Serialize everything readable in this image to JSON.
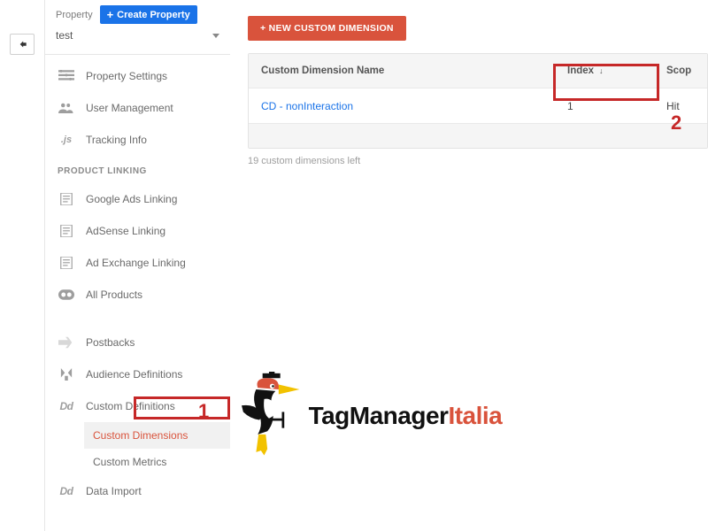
{
  "sidebar": {
    "property_label": "Property",
    "create_button": "Create Property",
    "selected_property": "test",
    "items": [
      {
        "label": "Property Settings"
      },
      {
        "label": "User Management"
      },
      {
        "label": "Tracking Info"
      }
    ],
    "section_product_linking": "PRODUCT LINKING",
    "product_items": [
      {
        "label": "Google Ads Linking"
      },
      {
        "label": "AdSense Linking"
      },
      {
        "label": "Ad Exchange Linking"
      },
      {
        "label": "All Products"
      }
    ],
    "lower_items": [
      {
        "label": "Postbacks"
      },
      {
        "label": "Audience Definitions"
      },
      {
        "label": "Custom Definitions"
      }
    ],
    "custom_sub": [
      {
        "label": "Custom Dimensions",
        "active": true
      },
      {
        "label": "Custom Metrics",
        "active": false
      }
    ],
    "data_import": {
      "label": "Data Import"
    }
  },
  "main": {
    "new_button": "+ NEW CUSTOM DIMENSION",
    "columns": {
      "name": "Custom Dimension Name",
      "index": "Index",
      "scope": "Scop"
    },
    "rows": [
      {
        "name": "CD - nonInteraction",
        "index": "1",
        "scope": "Hit"
      }
    ],
    "remaining": "19 custom dimensions left"
  },
  "annotations": {
    "one": "1",
    "two": "2"
  },
  "logo": {
    "brand_a": "TagManager",
    "brand_b": "Italia"
  }
}
